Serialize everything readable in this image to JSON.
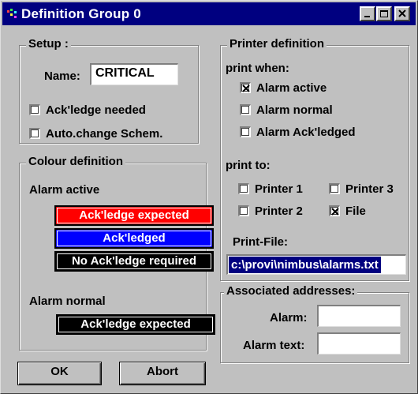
{
  "window": {
    "title": "Definition Group 0"
  },
  "setup": {
    "legend": "Setup :",
    "name_label": "Name:",
    "name_value": "CRITICAL",
    "ackledge_needed": {
      "label": "Ack'ledge needed",
      "checked": false
    },
    "auto_change": {
      "label": "Auto.change Schem.",
      "checked": false
    }
  },
  "colour": {
    "legend": "Colour definition",
    "alarm_active_label": "Alarm active",
    "swatches": [
      {
        "label": "Ack'ledge expected",
        "color": "#ff0000"
      },
      {
        "label": "Ack'ledged",
        "color": "#0000ff"
      },
      {
        "label": "No Ack'ledge required",
        "color": "#000000"
      }
    ],
    "alarm_normal_label": "Alarm normal",
    "normal_swatch": {
      "label": "Ack'ledge expected",
      "color": "#000000"
    }
  },
  "printer": {
    "legend": "Printer definition",
    "print_when_label": "print when:",
    "alarm_active": {
      "label": "Alarm active",
      "checked": true
    },
    "alarm_normal": {
      "label": "Alarm normal",
      "checked": false
    },
    "alarm_ackledged": {
      "label": "Alarm Ack'ledged",
      "checked": false
    },
    "print_to_label": "print to:",
    "printer1": {
      "label": "Printer 1",
      "checked": false
    },
    "printer3": {
      "label": "Printer 3",
      "checked": false
    },
    "printer2": {
      "label": "Printer 2",
      "checked": false
    },
    "file": {
      "label": "File",
      "checked": true
    },
    "print_file_label": "Print-File:",
    "print_file_value": "c:\\provi\\nimbus\\alarms.txt"
  },
  "addresses": {
    "legend": "Associated addresses:",
    "alarm_label": "Alarm:",
    "alarm_value": "",
    "alarm_text_label": "Alarm text:",
    "alarm_text_value": ""
  },
  "buttons": {
    "ok": "OK",
    "abort": "Abort"
  },
  "colors": {
    "titlebar": "#000080",
    "face": "#c0c0c0",
    "selection": "#000080"
  }
}
